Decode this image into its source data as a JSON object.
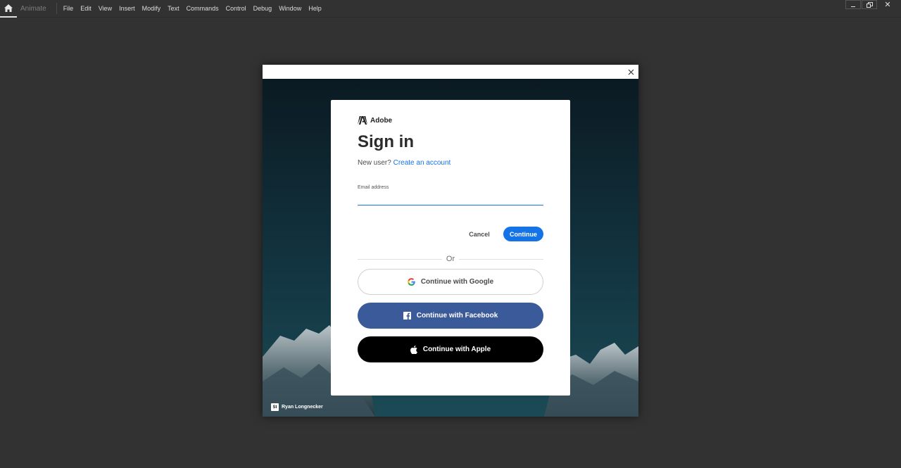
{
  "app": {
    "name": "Animate"
  },
  "menu": {
    "items": [
      {
        "label": "File"
      },
      {
        "label": "Edit"
      },
      {
        "label": "View"
      },
      {
        "label": "Insert"
      },
      {
        "label": "Modify"
      },
      {
        "label": "Text"
      },
      {
        "label": "Commands"
      },
      {
        "label": "Control"
      },
      {
        "label": "Debug"
      },
      {
        "label": "Window"
      },
      {
        "label": "Help"
      }
    ]
  },
  "window_controls": {
    "close_label": "✕"
  },
  "signin": {
    "brand": "Adobe",
    "title": "Sign in",
    "new_user_text": "New user?",
    "create_account_link": "Create an account",
    "email_label": "Email address",
    "email_value": "",
    "cancel_label": "Cancel",
    "continue_label": "Continue",
    "or_text": "Or",
    "google_label": "Continue with Google",
    "facebook_label": "Continue with Facebook",
    "apple_label": "Continue with Apple"
  },
  "photo_credit": {
    "badge": "St",
    "name": "Ryan Longnecker"
  },
  "colors": {
    "accent_blue": "#1473e6",
    "facebook_blue": "#3b5a9a",
    "apple_black": "#000000",
    "app_background": "#323232"
  },
  "icons": {
    "home": "home-icon",
    "minimize": "minimize-icon",
    "restore": "restore-icon",
    "close": "close-icon",
    "adobe": "adobe-logo-icon",
    "google": "google-icon",
    "facebook": "facebook-icon",
    "apple": "apple-icon"
  }
}
